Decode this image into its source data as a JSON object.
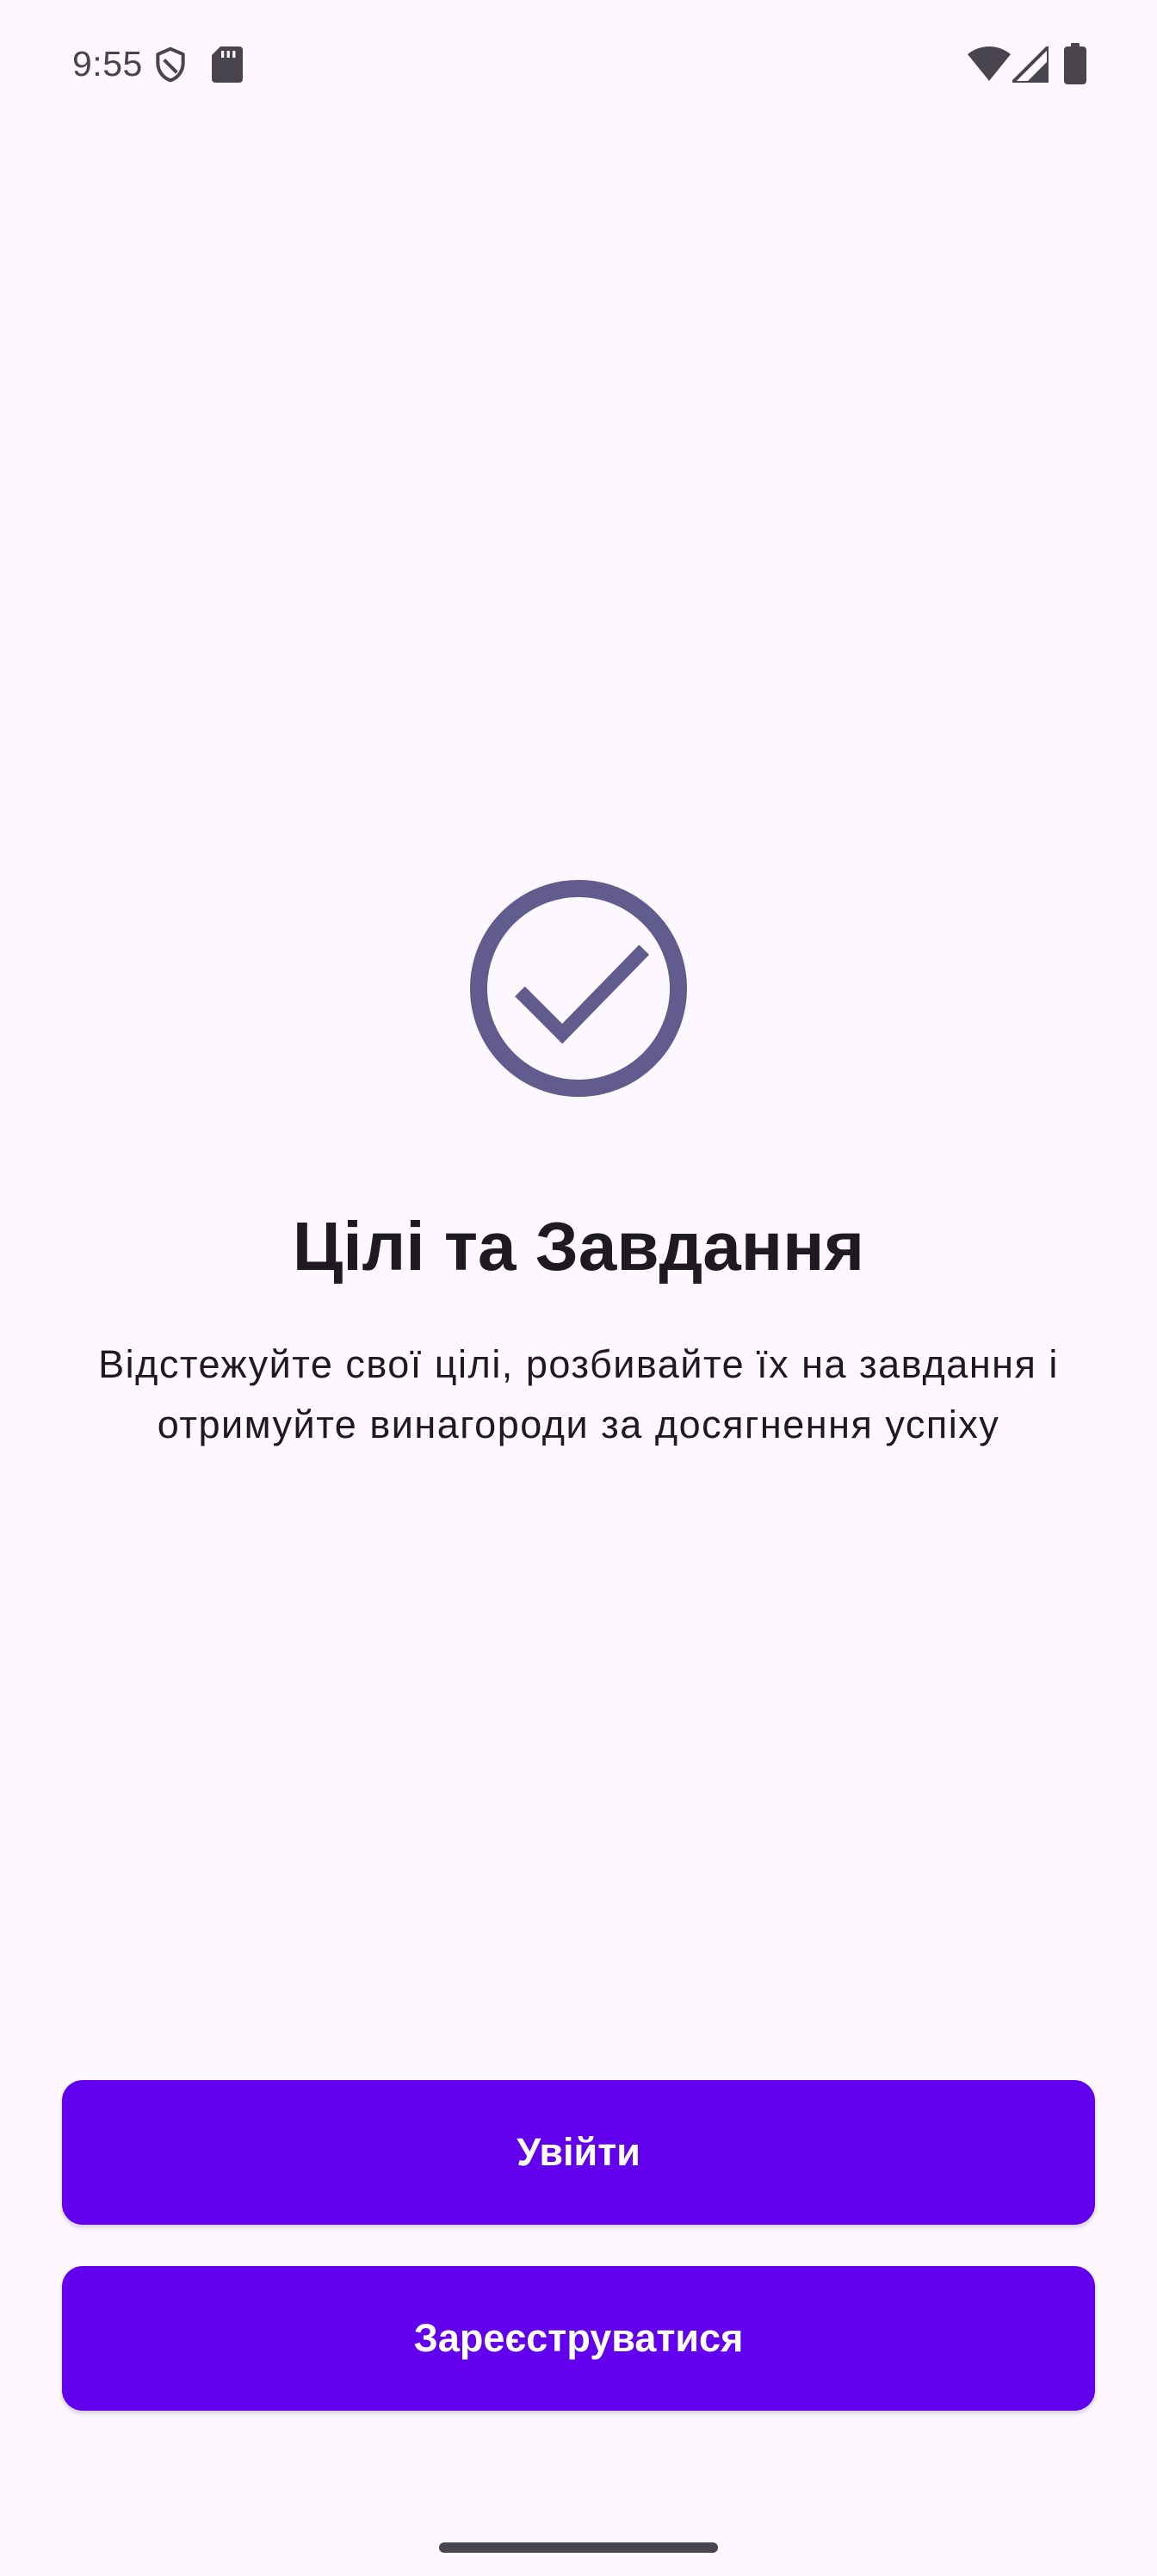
{
  "status_bar": {
    "time": "9:55",
    "icons": [
      "shield-icon",
      "sdcard-icon",
      "wifi-icon",
      "cell-signal-icon",
      "battery-icon"
    ]
  },
  "hero": {
    "icon": "check-circle-icon",
    "title": "Цілі та Завдання",
    "subtitle_line1": "Відстежуйте свої цілі, розбивайте їх на завдання і",
    "subtitle_line2": "отримуйте винагороди за досягнення успіху"
  },
  "actions": {
    "login_label": "Увійти",
    "register_label": "Зареєструватися"
  },
  "colors": {
    "background": "#FDF7FF",
    "primary_button": "#6200EE",
    "icon_accent": "#625B8E",
    "text": "#1D1B20"
  }
}
